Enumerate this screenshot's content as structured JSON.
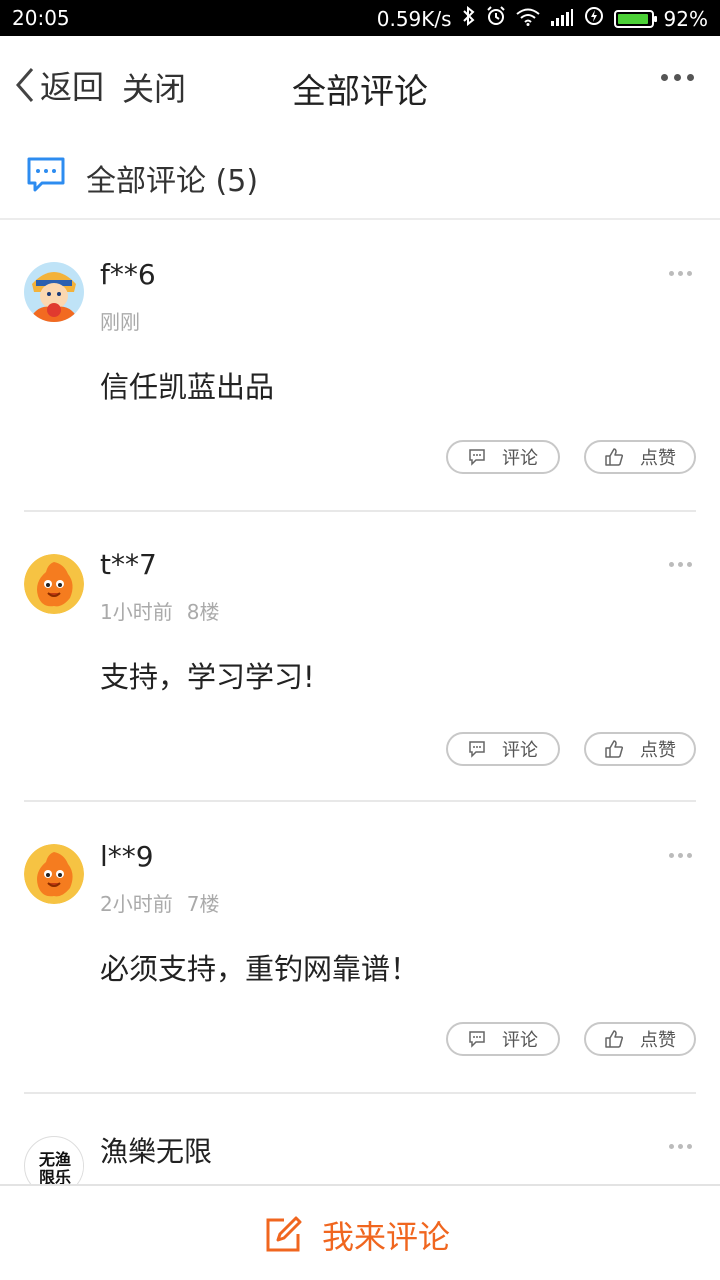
{
  "status_bar": {
    "time": "20:05",
    "network_speed": "0.59K/s",
    "battery_percent": "92%",
    "icons": [
      "bluetooth-icon",
      "alarm-icon",
      "wifi-icon",
      "signal-icon",
      "charging-icon",
      "battery-icon"
    ]
  },
  "nav": {
    "back_label": "返回",
    "close_label": "关闭",
    "title": "全部评论"
  },
  "section": {
    "title": "全部评论 (5)"
  },
  "comments": [
    {
      "name": "f**6",
      "time": "刚刚",
      "floor": "",
      "text": "信任凯蓝出品",
      "avatar": "anime-avatar"
    },
    {
      "name": "t**7",
      "time": "1小时前",
      "floor": "8楼",
      "text": "支持，学习学习!",
      "avatar": "orange-mascot-avatar"
    },
    {
      "name": "l**9",
      "time": "2小时前",
      "floor": "7楼",
      "text": "必须支持，重钓网靠谱！",
      "avatar": "orange-mascot-avatar"
    },
    {
      "name": "漁樂无限",
      "time": "",
      "floor": "",
      "text": "",
      "avatar": "calligraphy-avatar"
    }
  ],
  "actions": {
    "comment_label": "评论",
    "like_label": "点赞"
  },
  "avatar_text": "无渔限乐",
  "bottom": {
    "write_label": "我来评论"
  },
  "colors": {
    "accent": "#f0661f",
    "section_icon": "#2d8cf0",
    "battery": "#4cd137",
    "mascot": "#f57c1f"
  }
}
